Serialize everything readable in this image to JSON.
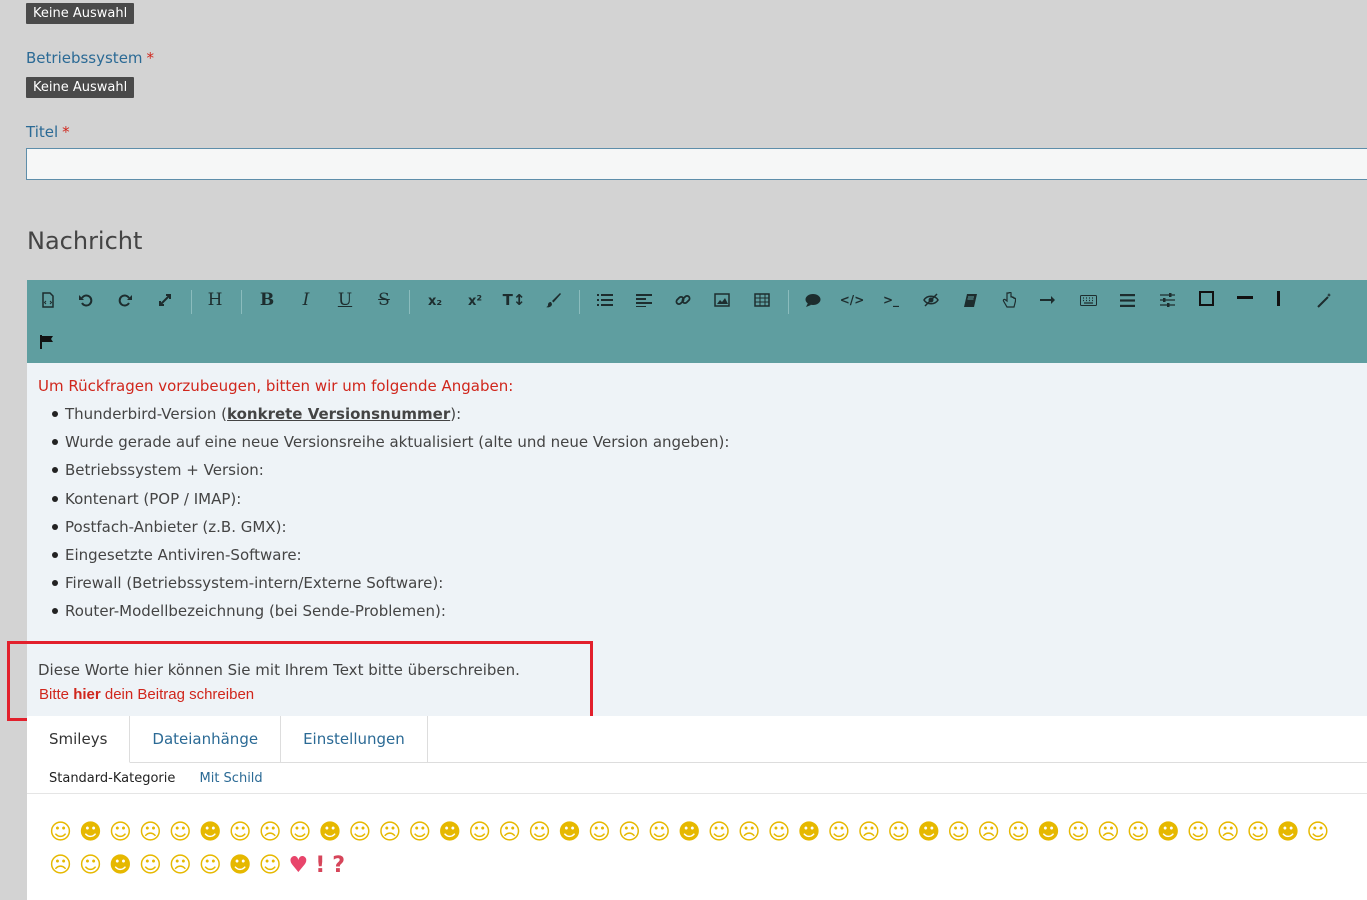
{
  "fields": {
    "top_badge": "Keine Auswahl",
    "os_label": "Betriebssystem",
    "os_required": "*",
    "os_badge": "Keine Auswahl",
    "title_label": "Titel",
    "title_required": "*",
    "title_value": ""
  },
  "message_heading": "Nachricht",
  "toolbar": {
    "heading_btn": "H",
    "bold_btn": "B",
    "italic_btn": "I",
    "underline_btn": "U",
    "strike_btn": "S",
    "sub_btn": "x₂",
    "sup_btn": "x²",
    "size_btn": "T↕",
    "code_btn": "</>",
    "tt_btn": ">_"
  },
  "editor": {
    "intro": "Um Rückfragen vorzubeugen, bitten wir um folgende Angaben:",
    "bullet0_pre": "Thunderbird-Version (",
    "bullet0_bold": "konkrete Versionsnummer",
    "bullet0_post": "):",
    "bullets": [
      "Wurde gerade auf eine neue Versionsreihe aktualisiert (alte und neue Version angeben):",
      "Betriebssystem + Version:",
      "Kontenart (POP / IMAP):",
      "Postfach-Anbieter (z.B. GMX):",
      "Eingesetzte Antiviren-Software:",
      "Firewall (Betriebssystem-intern/Externe Software):",
      "Router-Modellbezeichnung (bei Sende-Problemen):"
    ],
    "overwrite_hint": "Diese Worte hier können Sie mit Ihrem Text bitte überschreiben.",
    "write_pre": "Bitte ",
    "write_bold": "hier",
    "write_post": " dein Beitrag schreiben"
  },
  "tabs": {
    "smileys": "Smileys",
    "attachments": "Dateianhänge",
    "settings": "Einstellungen"
  },
  "subtabs": {
    "standard": "Standard-Kategorie",
    "sign": "Mit Schild"
  },
  "colors": {
    "toolbar_bg": "#5f9ea0",
    "editor_bg": "#eef3f7",
    "required": "#d0261c",
    "link": "#2b6a95",
    "highlight_box": "#e2202c"
  }
}
